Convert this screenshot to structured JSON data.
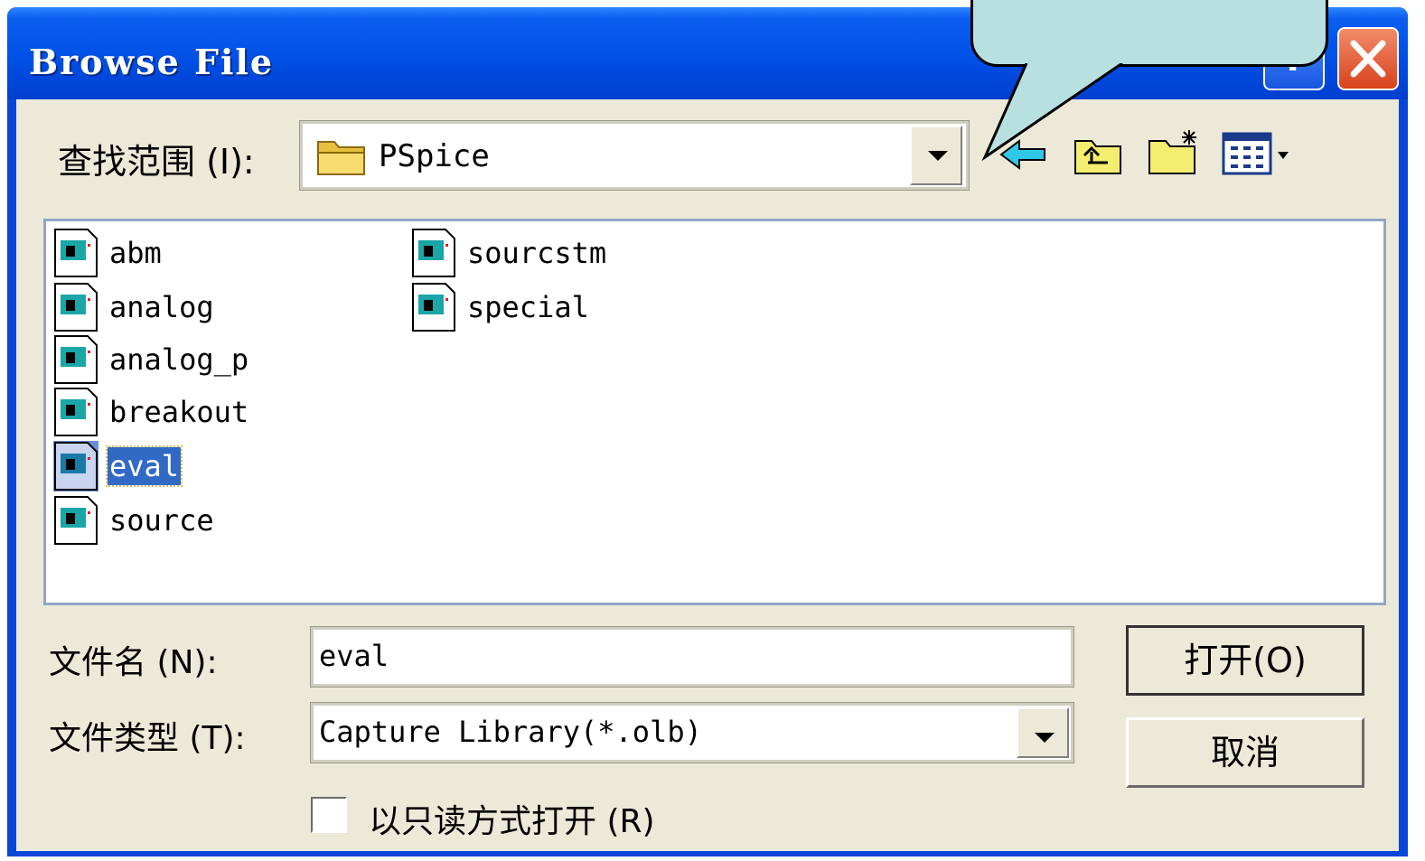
{
  "window": {
    "title": "Browse File",
    "help_label": "?"
  },
  "lookin": {
    "label": "查找范围 (I):",
    "value": "PSpice"
  },
  "toolbar": {
    "icons": [
      "back-arrow-icon",
      "up-folder-icon",
      "new-folder-icon",
      "view-menu-icon"
    ]
  },
  "files": {
    "items": [
      {
        "name": "abm"
      },
      {
        "name": "analog"
      },
      {
        "name": "analog_p"
      },
      {
        "name": "breakout"
      },
      {
        "name": "eval",
        "selected": true
      },
      {
        "name": "source"
      },
      {
        "name": "sourcstm"
      },
      {
        "name": "special"
      }
    ]
  },
  "filename": {
    "label": "文件名 (N):",
    "value": "eval"
  },
  "filetype": {
    "label": "文件类型 (T):",
    "value": "Capture Library(*.olb)"
  },
  "buttons": {
    "open": "打开(O)",
    "cancel": "取消"
  },
  "readonly": {
    "label": "以只读方式打开 (R)",
    "checked": false
  },
  "colors": {
    "title_bar": "#0050e6",
    "dialog_bg": "#ece9d8",
    "selection": "#316ac5",
    "callout": "#b9e0e0"
  }
}
